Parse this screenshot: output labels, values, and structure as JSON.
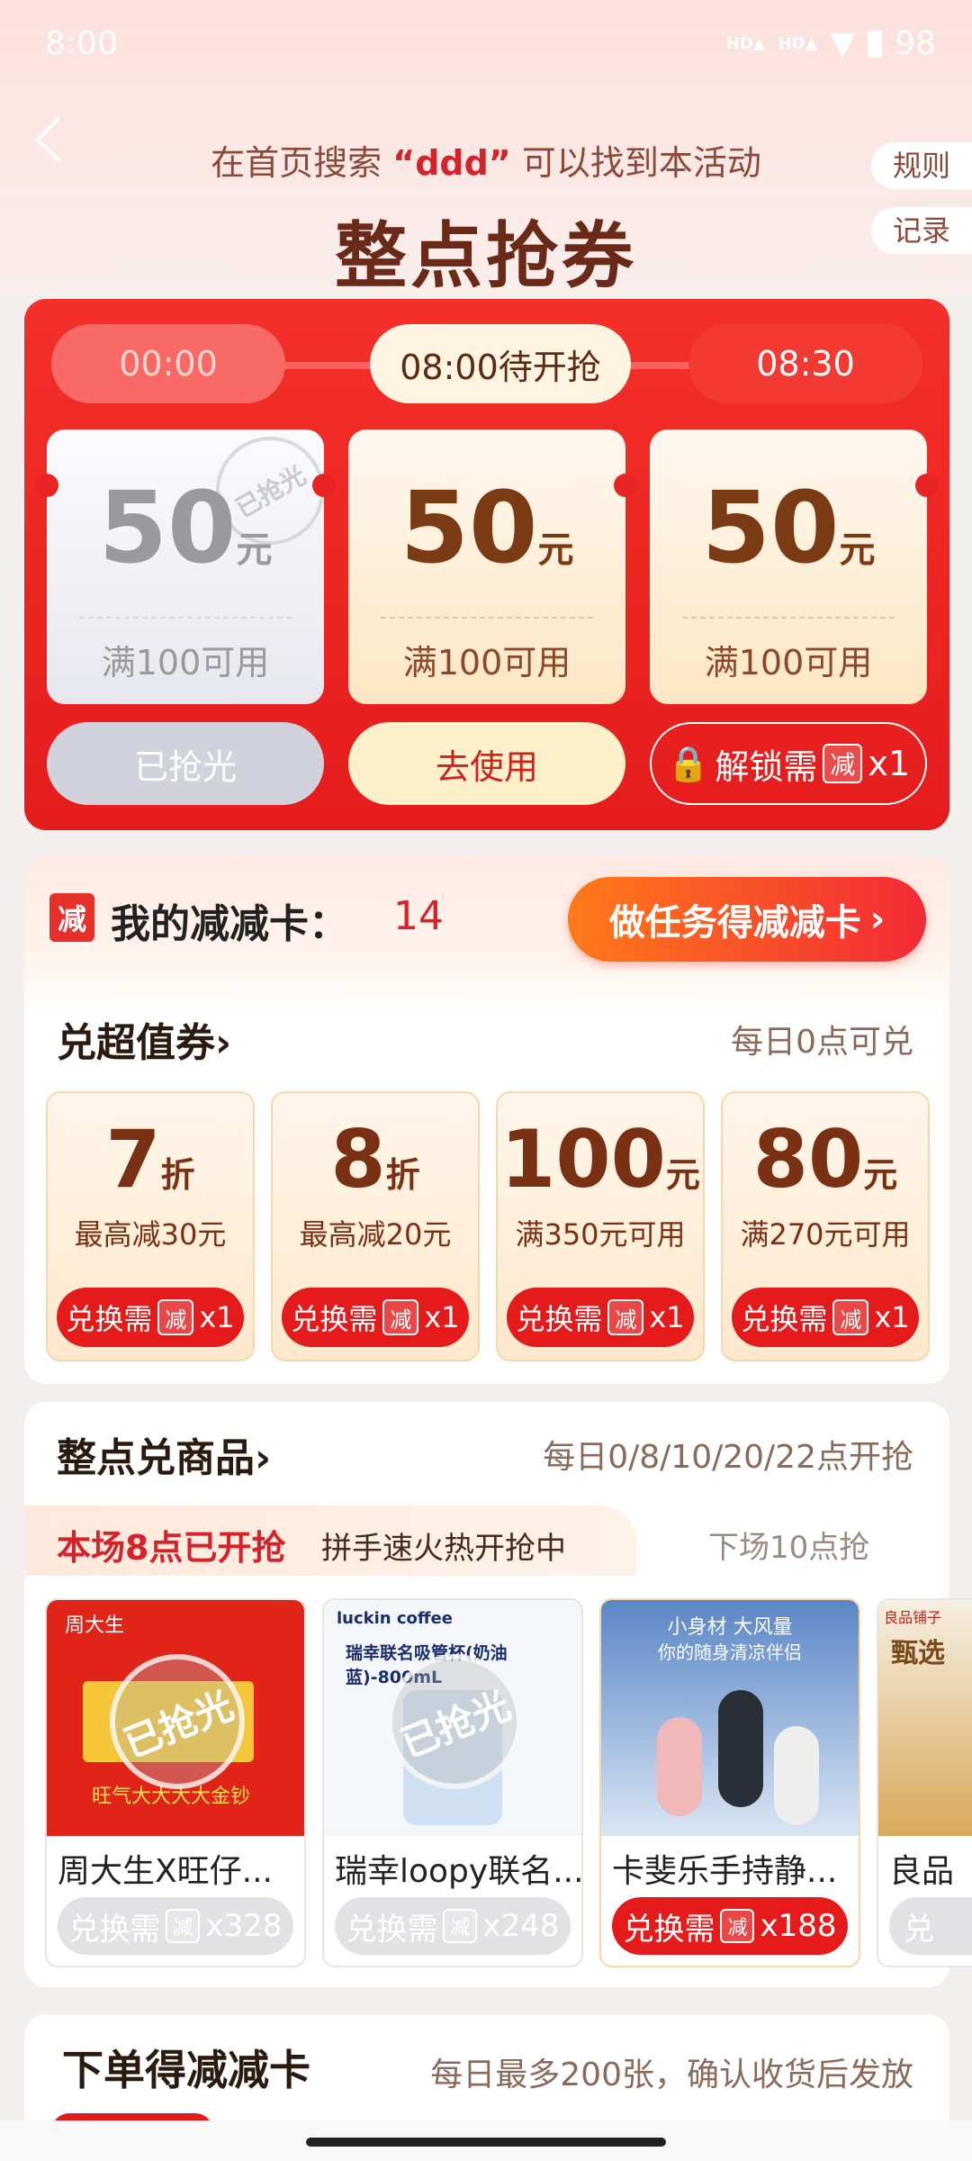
{
  "status_bar": {
    "time": "8:00",
    "signal": "HD",
    "battery": "98"
  },
  "header": {
    "hint_prefix": "在首页搜索",
    "hint_keyword": "“ddd”",
    "hint_suffix": "可以找到本活动",
    "title": "整点抢券",
    "rules_label": "规则",
    "records_label": "记录"
  },
  "flash": {
    "tabs": [
      {
        "label": "00:00",
        "state": "past"
      },
      {
        "label": "08:00待开抢",
        "state": "active"
      },
      {
        "label": "08:30",
        "state": "future"
      }
    ],
    "coupons": [
      {
        "amount": "50",
        "unit": "元",
        "condition": "满100可用",
        "stamp": "已抢光",
        "button": "已抢光"
      },
      {
        "amount": "50",
        "unit": "元",
        "condition": "满100可用",
        "button": "去使用"
      },
      {
        "amount": "50",
        "unit": "元",
        "condition": "满100可用",
        "button_prefix": "解锁需",
        "button_badge": "减",
        "button_count": "x1"
      }
    ]
  },
  "my_card": {
    "badge": "减",
    "label": "我的减减卡：",
    "count": "14",
    "task_button": "做任务得减减卡"
  },
  "exchange": {
    "title": "兑超值券›",
    "note": "每日0点可兑",
    "vouchers": [
      {
        "value": "7",
        "unit": "折",
        "desc": "最高减30元",
        "btn_prefix": "兑换需",
        "btn_badge": "减",
        "btn_count": "x1"
      },
      {
        "value": "8",
        "unit": "折",
        "desc": "最高减20元",
        "btn_prefix": "兑换需",
        "btn_badge": "减",
        "btn_count": "x1"
      },
      {
        "value": "100",
        "unit": "元",
        "desc": "满350元可用",
        "btn_prefix": "兑换需",
        "btn_badge": "减",
        "btn_count": "x1"
      },
      {
        "value": "80",
        "unit": "元",
        "desc": "满270元可用",
        "btn_prefix": "兑换需",
        "btn_badge": "减",
        "btn_count": "x1"
      }
    ]
  },
  "products": {
    "title": "整点兑商品›",
    "schedule": "每日0/8/10/20/22点开抢",
    "current_label": "本场8点已开抢",
    "current_sub": "拼手速火热开抢中",
    "next_label": "下场10点抢",
    "items": [
      {
        "name": "周大生X旺仔...",
        "btn_prefix": "兑换需",
        "btn_badge": "减",
        "btn_count": "x328",
        "sold_out": "已抢光",
        "brand": "周大生",
        "art_text": "旺气大大大大金钞"
      },
      {
        "name": "瑞幸loopy联名...",
        "btn_prefix": "兑换需",
        "btn_badge": "减",
        "btn_count": "x248",
        "sold_out": "已抢光",
        "brand": "luckin coffee",
        "art_text": "瑞幸联名吸管杯(奶油蓝)-800mL"
      },
      {
        "name": "卡斐乐手持静...",
        "btn_prefix": "兑换需",
        "btn_badge": "减",
        "btn_count": "x188",
        "art_text": "小身材 大风量",
        "art_sub": "你的随身清凉伴侣"
      },
      {
        "name": "良品",
        "btn_prefix": "兑",
        "brand": "良品铺子",
        "art_text": "甄选"
      }
    ]
  },
  "order_section": {
    "title": "下单得减减卡",
    "note": "每日最多200张，确认收货后发放"
  }
}
